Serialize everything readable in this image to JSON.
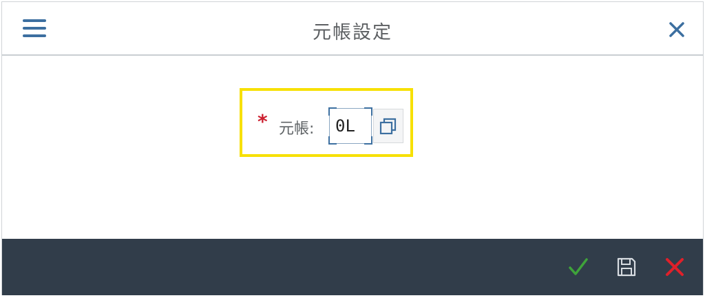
{
  "header": {
    "title": "元帳設定",
    "menu_icon": "hamburger-menu-icon",
    "close_icon": "close-icon"
  },
  "form": {
    "required_marker": "*",
    "ledger_label": "元帳:",
    "ledger_value": "0L",
    "value_help_icon": "value-help-icon"
  },
  "footer": {
    "confirm_icon": "checkmark-icon",
    "save_icon": "save-icon",
    "cancel_icon": "cancel-icon"
  },
  "colors": {
    "accent": "#3c6fa0",
    "highlight": "#f7e000",
    "footer_bg": "#313d4a",
    "required": "#cc1f2f",
    "confirm": "#3fa33a",
    "cancel": "#e0202a"
  }
}
